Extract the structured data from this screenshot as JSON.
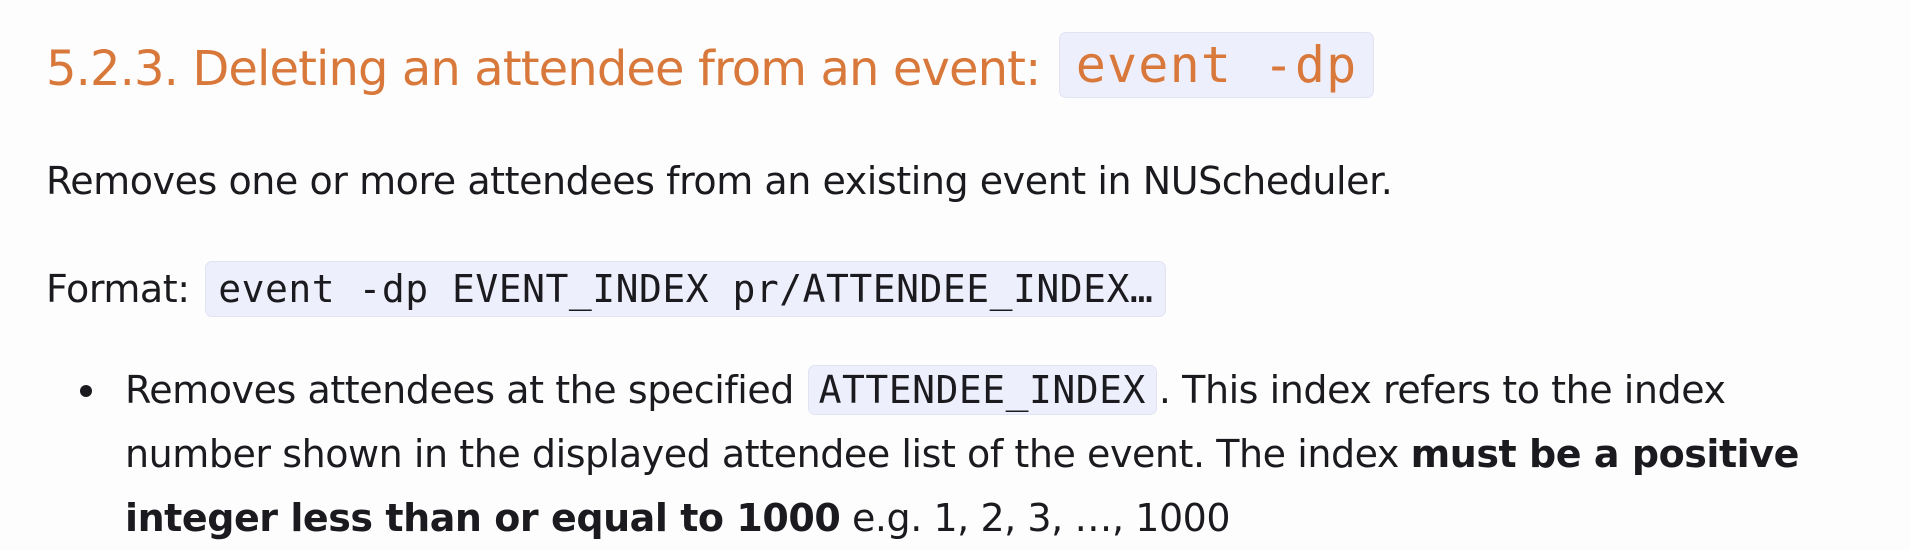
{
  "heading": {
    "text": "5.2.3. Deleting an attendee from an event:",
    "command": "event -dp"
  },
  "description": "Removes one or more attendees from an existing event in NUScheduler.",
  "format": {
    "label": "Format:",
    "code": "event -dp EVENT_INDEX pr/ATTENDEE_INDEX…"
  },
  "bullets": [
    {
      "part1": "Removes attendees at the specified",
      "code": "ATTENDEE_INDEX",
      "part2": ". This index refers to the index",
      "part3": "number shown in the displayed attendee list of the event. The index",
      "bold1": "must be a positive",
      "bold2": "integer less than or equal to 1000",
      "part4": "e.g. 1, 2, 3, …, 1000"
    }
  ],
  "colors": {
    "heading": "#d8783a",
    "code_background": "#eeeffc",
    "text": "#1b1b1f"
  }
}
